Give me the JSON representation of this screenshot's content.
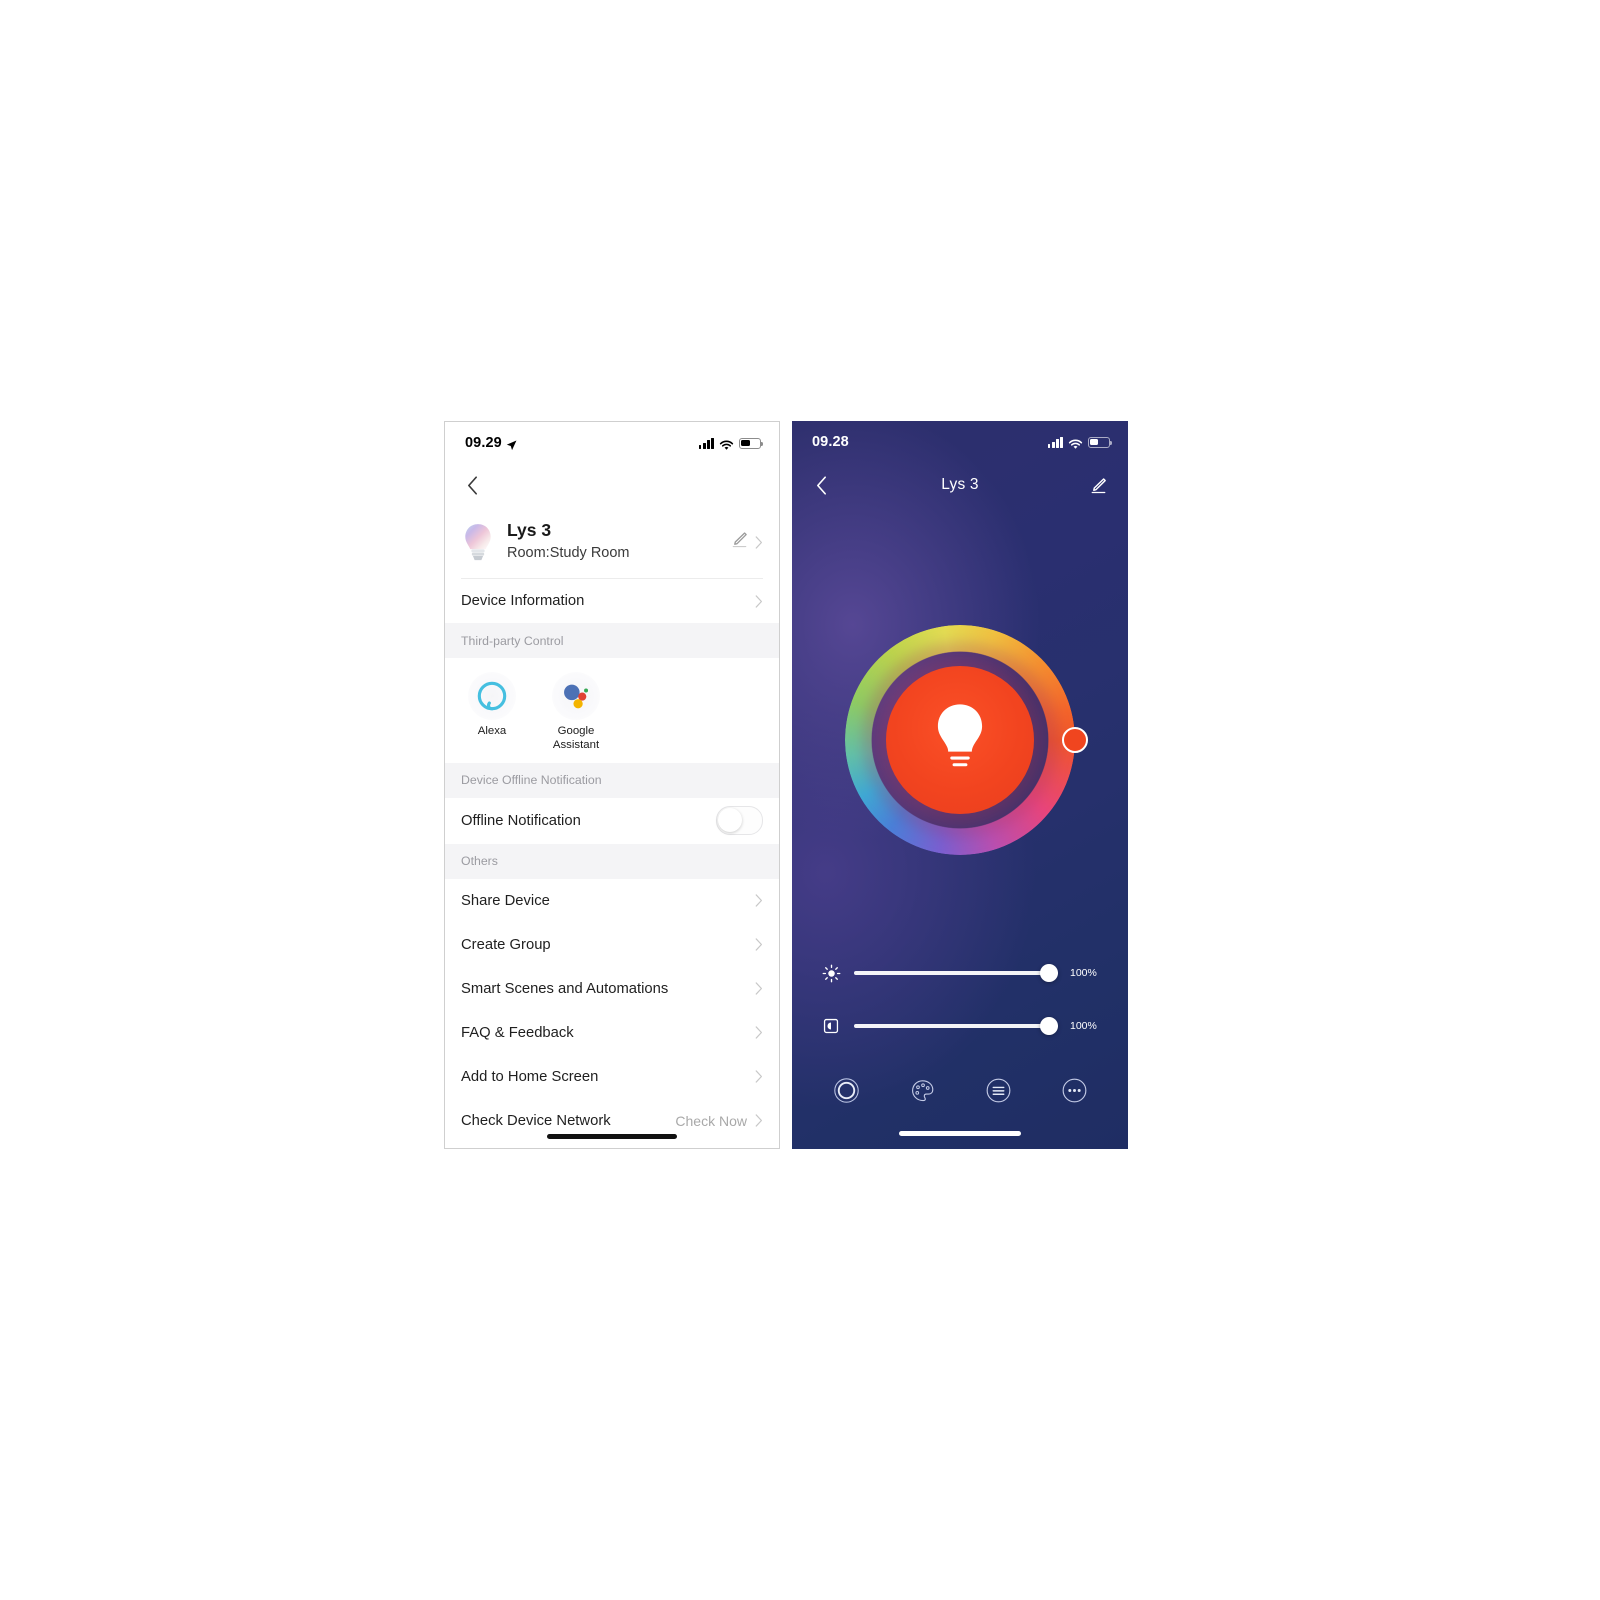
{
  "left_phone": {
    "status_bar": {
      "time": "09.29",
      "location_icon": "location-arrow-icon",
      "signal_icon": "cellular-signal-icon",
      "wifi_icon": "wifi-icon",
      "battery_icon": "battery-icon"
    },
    "nav": {
      "back_icon": "chevron-left-icon"
    },
    "device": {
      "icon": "smart-bulb-icon",
      "name": "Lys 3",
      "room": "Room:Study Room",
      "edit_icon": "pencil-icon",
      "chevron_icon": "chevron-right-icon"
    },
    "rows_top": [
      {
        "label": "Device Information",
        "aux": "",
        "chevron": "chevron-right-icon"
      }
    ],
    "section_third_party": {
      "title": "Third-party Control",
      "items": [
        {
          "label": "Alexa",
          "icon": "alexa-icon"
        },
        {
          "label": "Google\nAssistant",
          "icon": "google-assistant-icon"
        }
      ]
    },
    "section_offline": {
      "title": "Device Offline Notification",
      "toggle_label": "Offline Notification",
      "toggle_state": "off"
    },
    "section_others": {
      "title": "Others",
      "items": [
        {
          "label": "Share Device",
          "aux": ""
        },
        {
          "label": "Create Group",
          "aux": ""
        },
        {
          "label": "Smart Scenes and Automations",
          "aux": ""
        },
        {
          "label": "FAQ & Feedback",
          "aux": ""
        },
        {
          "label": "Add to Home Screen",
          "aux": ""
        },
        {
          "label": "Check Device Network",
          "aux": "Check Now"
        }
      ]
    }
  },
  "right_phone": {
    "status_bar": {
      "time": "09.28",
      "signal_icon": "cellular-signal-icon",
      "wifi_icon": "wifi-icon",
      "battery_icon": "battery-icon"
    },
    "nav": {
      "back_icon": "chevron-left-icon",
      "title": "Lys 3",
      "edit_icon": "pencil-icon"
    },
    "color_wheel": {
      "selected_color": "#f0451f",
      "handle_angle_deg": 0,
      "bulb_icon": "light-bulb-icon"
    },
    "sliders": [
      {
        "icon": "brightness-sun-icon",
        "value": "100%",
        "percent": 100
      },
      {
        "icon": "color-temperature-icon",
        "value": "100%",
        "percent": 100
      }
    ],
    "bottom_nav": [
      {
        "icon": "power-circle-icon",
        "name": "white-light-tab"
      },
      {
        "icon": "palette-icon",
        "name": "color-tab"
      },
      {
        "icon": "scene-list-icon",
        "name": "scene-tab"
      },
      {
        "icon": "more-ellipsis-icon",
        "name": "more-tab"
      }
    ]
  },
  "colors": {
    "accent_red": "#f0451f",
    "dark_bg_top": "#2e2f6d",
    "dark_bg_bottom": "#1f2d63",
    "section_bg": "#f4f4f6",
    "text_primary": "#1f1f1f",
    "text_muted": "#9b9ba1"
  }
}
